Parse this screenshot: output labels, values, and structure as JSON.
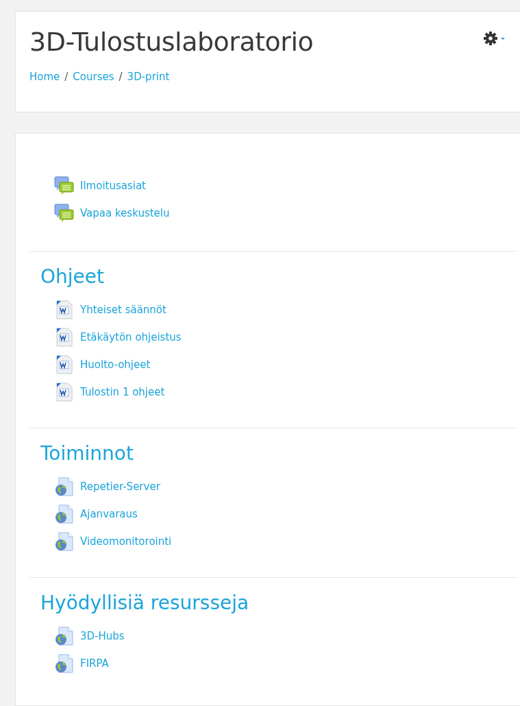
{
  "header": {
    "title": "3D-Tulostuslaboratorio",
    "breadcrumb": [
      "Home",
      "Courses",
      "3D-print"
    ],
    "separator": "/"
  },
  "sections": [
    {
      "items": [
        {
          "kind": "forum",
          "label": "Ilmoitusasiat"
        },
        {
          "kind": "forum",
          "label": "Vapaa keskustelu"
        }
      ]
    },
    {
      "title": "Ohjeet",
      "items": [
        {
          "kind": "word",
          "label": "Yhteiset säännöt"
        },
        {
          "kind": "word",
          "label": "Etäkäytön ohjeistus"
        },
        {
          "kind": "word",
          "label": "Huolto-ohjeet"
        },
        {
          "kind": "word",
          "label": "Tulostin 1 ohjeet"
        }
      ]
    },
    {
      "title": "Toiminnot",
      "items": [
        {
          "kind": "url",
          "label": "Repetier-Server"
        },
        {
          "kind": "url",
          "label": "Ajanvaraus"
        },
        {
          "kind": "url",
          "label": "Videomonitorointi"
        }
      ]
    },
    {
      "title": "Hyödyllisiä resursseja",
      "items": [
        {
          "kind": "url",
          "label": "3D-Hubs"
        },
        {
          "kind": "url",
          "label": "FIRPA"
        }
      ]
    }
  ]
}
